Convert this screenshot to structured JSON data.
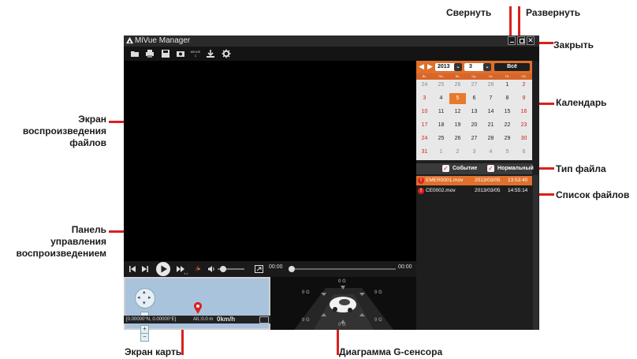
{
  "app": {
    "title": "MiVue Manager"
  },
  "annotations": {
    "minimize": "Свернуть",
    "maximize": "Развернуть",
    "close": "Закрыть",
    "playback_screen": "Экран\nвоспроизведения\nфайлов",
    "calendar": "Календарь",
    "file_type": "Тип файла",
    "file_list": "Список файлов",
    "control_panel": "Панель\nуправления\nвоспроизведением",
    "map_screen": "Экран карты",
    "gsensor_chart": "Диаграмма G-сенсора"
  },
  "toolbar": {
    "icons": [
      "folder-open-icon",
      "print-icon",
      "save-icon",
      "snapshot-icon",
      "mivue-settings-icon",
      "download-icon",
      "gear-icon"
    ],
    "mivue_label": "MIVUE"
  },
  "controls": {
    "time_current": "00:00",
    "time_total": "00:00",
    "speed_label": "1 x"
  },
  "map": {
    "coords": "[0.00000°N, 0.00000°E]",
    "alt": "Alt.:0.0 m",
    "speed": "0km/h"
  },
  "gsensor": {
    "labels": [
      "0 G",
      "0 G",
      "0 G",
      "0 G",
      "0 G",
      "0 G"
    ]
  },
  "calendar": {
    "year": "2013",
    "month": "3",
    "all_button": "Всё",
    "weekdays": [
      "Вс.",
      "Пн.",
      "Вт.",
      "Ср.",
      "Чт.",
      "Пт.",
      "Сб."
    ],
    "weeks": [
      [
        "24",
        "25",
        "26",
        "27",
        "28",
        "1",
        "2"
      ],
      [
        "3",
        "4",
        "5",
        "6",
        "7",
        "8",
        "9"
      ],
      [
        "10",
        "11",
        "12",
        "13",
        "14",
        "15",
        "16"
      ],
      [
        "17",
        "18",
        "19",
        "20",
        "21",
        "22",
        "23"
      ],
      [
        "24",
        "25",
        "26",
        "27",
        "28",
        "29",
        "30"
      ],
      [
        "31",
        "1",
        "2",
        "3",
        "4",
        "5",
        "6"
      ]
    ],
    "selected": "5"
  },
  "file_type": {
    "event": "Событие",
    "normal": "Нормальный"
  },
  "files": [
    {
      "name": "EMER0001.mov",
      "date": "2013/03/05",
      "time": "13:53:40",
      "selected": true
    },
    {
      "name": "CE0002.mov",
      "date": "2013/03/05",
      "time": "14:55:14",
      "selected": false
    }
  ],
  "colors": {
    "accent": "#e0702c",
    "callout": "#d9201e"
  }
}
